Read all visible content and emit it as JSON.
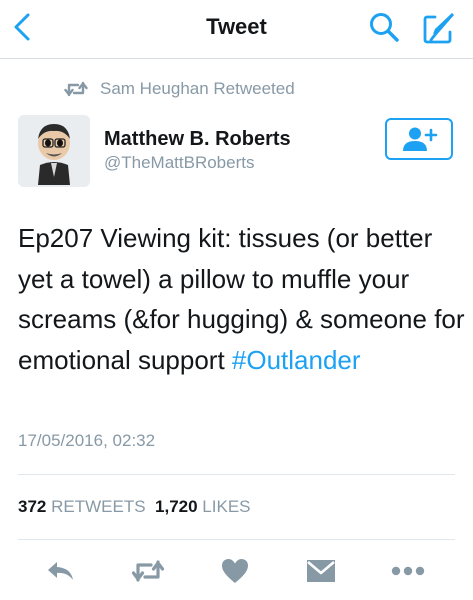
{
  "nav": {
    "title": "Tweet",
    "back_icon": "chevron-left-icon",
    "search_icon": "search-icon",
    "compose_icon": "compose-icon",
    "accent_color": "#1da1f2"
  },
  "retweet_context": {
    "icon": "retweet-icon",
    "label": "Sam Heughan Retweeted"
  },
  "author": {
    "name": "Matthew B. Roberts",
    "handle": "@TheMattBRoberts",
    "follow_icon": "add-user-icon"
  },
  "tweet": {
    "text": "Ep207 Viewing kit: tissues (or better yet a towel) a pillow to muffle your screams (&for hugging) & someone for emotional support ",
    "hashtag": "#Outlander",
    "timestamp": "17/05/2016, 02:32"
  },
  "stats": {
    "retweets_count": "372",
    "retweets_label": "RETWEETS",
    "likes_count": "1,720",
    "likes_label": "LIKES"
  },
  "actions": [
    "reply-icon",
    "retweet-icon",
    "like-icon",
    "direct-message-icon",
    "more-icon"
  ]
}
